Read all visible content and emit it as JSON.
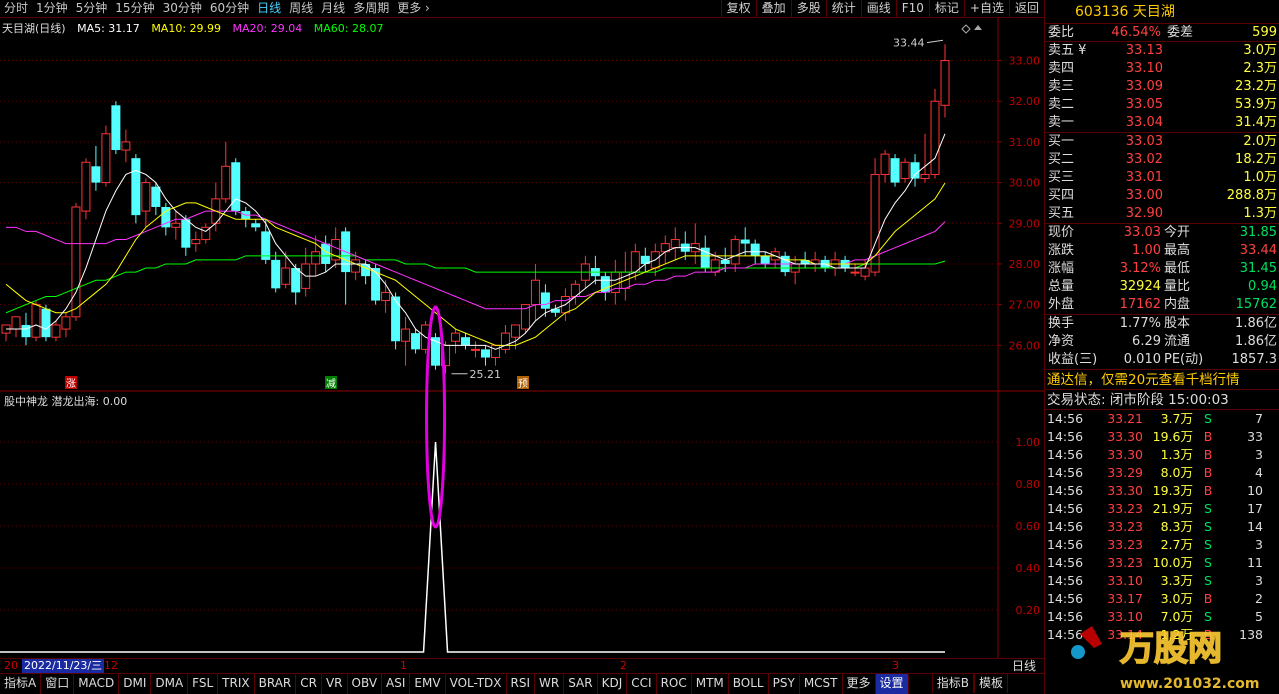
{
  "toolbar": {
    "periods": [
      "分时",
      "1分钟",
      "5分钟",
      "15分钟",
      "30分钟",
      "60分钟",
      "日线",
      "周线",
      "月线",
      "多周期",
      "更多"
    ],
    "active_period": "日线",
    "tools": [
      "复权",
      "叠加",
      "多股",
      "统计",
      "画线",
      "F10",
      "标记",
      "+自选",
      "返回"
    ]
  },
  "chart_title": {
    "name": "天目湖(日线)",
    "ma5": "MA5: 31.17",
    "ma10": "MA10: 29.99",
    "ma20": "MA20: 29.04",
    "ma60": "MA60: 28.07"
  },
  "price_axis": [
    "33.00",
    "32.00",
    "31.00",
    "30.00",
    "29.00",
    "28.00",
    "27.00",
    "26.00"
  ],
  "indicator_axis": [
    "1.00",
    "0.80",
    "0.60",
    "0.40",
    "0.20"
  ],
  "annotations": {
    "high": "33.44",
    "low": "25.21",
    "markers": [
      "涨",
      "减",
      "预"
    ]
  },
  "indicator_title": {
    "name": "股中神龙",
    "line": "潜龙出海: 0.00"
  },
  "timebar": {
    "date": "2022/11/23/三",
    "ticks": [
      "20",
      "12",
      "1",
      "2",
      "3"
    ],
    "daily": "日线"
  },
  "tabs": [
    "指标A",
    "窗口",
    "MACD",
    "DMI",
    "DMA",
    "FSL",
    "TRIX",
    "BRAR",
    "CR",
    "VR",
    "OBV",
    "ASI",
    "EMV",
    "VOL-TDX",
    "RSI",
    "WR",
    "SAR",
    "KDJ",
    "CCI",
    "ROC",
    "MTM",
    "BOLL",
    "PSY",
    "MCST",
    "更多",
    "设置"
  ],
  "tabs_right": [
    "指标B",
    "模板"
  ],
  "colors": {
    "up": "#ff3333",
    "down": "#54ffff",
    "ma5": "#ffffff",
    "ma10": "#ffff00",
    "ma20": "#ff33ff",
    "ma60": "#00ff00",
    "ellipse": "#e000e0"
  },
  "chart_data": {
    "type": "candlestick",
    "ylim": [
      25.0,
      33.8
    ],
    "candles": [
      [
        26.3,
        26.5,
        26.1,
        26.4
      ],
      [
        26.4,
        26.7,
        26.2,
        26.5
      ],
      [
        26.5,
        26.2,
        26.0,
        26.8
      ],
      [
        26.2,
        27.0,
        26.1,
        27.1
      ],
      [
        26.9,
        26.2,
        26.1,
        27.0
      ],
      [
        26.2,
        26.5,
        26.1,
        26.6
      ],
      [
        26.4,
        26.7,
        26.2,
        26.8
      ],
      [
        26.7,
        29.4,
        26.6,
        29.5
      ],
      [
        29.3,
        30.5,
        29.1,
        30.6
      ],
      [
        30.4,
        30.0,
        29.8,
        30.9
      ],
      [
        30.0,
        31.2,
        29.9,
        31.4
      ],
      [
        31.9,
        30.8,
        30.7,
        32.0
      ],
      [
        30.8,
        31.0,
        30.5,
        31.3
      ],
      [
        30.6,
        29.2,
        29.0,
        30.7
      ],
      [
        29.3,
        30.0,
        28.9,
        30.1
      ],
      [
        29.9,
        29.4,
        29.2,
        30.0
      ],
      [
        29.4,
        28.9,
        28.7,
        29.5
      ],
      [
        28.9,
        29.0,
        28.6,
        29.3
      ],
      [
        29.1,
        28.4,
        28.2,
        29.2
      ],
      [
        28.5,
        28.6,
        28.3,
        28.8
      ],
      [
        28.6,
        28.9,
        28.5,
        29.0
      ],
      [
        29.0,
        29.6,
        28.8,
        30.0
      ],
      [
        29.6,
        30.4,
        29.5,
        31.0
      ],
      [
        30.5,
        29.3,
        29.2,
        30.6
      ],
      [
        29.3,
        29.1,
        28.9,
        29.4
      ],
      [
        29.0,
        28.9,
        28.8,
        29.1
      ],
      [
        28.8,
        28.1,
        28.0,
        29.1
      ],
      [
        28.1,
        27.4,
        27.3,
        28.3
      ],
      [
        27.5,
        27.9,
        27.4,
        28.3
      ],
      [
        27.9,
        27.3,
        27.0,
        28.0
      ],
      [
        27.4,
        28.0,
        27.2,
        28.4
      ],
      [
        28.0,
        28.3,
        27.7,
        28.7
      ],
      [
        28.5,
        28.0,
        27.8,
        28.7
      ],
      [
        28.1,
        28.6,
        27.9,
        28.9
      ],
      [
        28.8,
        27.8,
        27.0,
        28.9
      ],
      [
        27.8,
        28.1,
        27.6,
        28.3
      ],
      [
        28.0,
        27.7,
        27.5,
        28.1
      ],
      [
        27.9,
        27.1,
        27.0,
        28.0
      ],
      [
        27.1,
        27.3,
        26.8,
        27.6
      ],
      [
        27.2,
        26.1,
        25.9,
        27.3
      ],
      [
        26.1,
        26.4,
        25.5,
        26.7
      ],
      [
        26.3,
        25.9,
        25.8,
        26.4
      ],
      [
        25.9,
        26.5,
        25.8,
        26.6
      ],
      [
        26.2,
        25.5,
        25.4,
        26.3
      ],
      [
        25.5,
        26.0,
        25.3,
        26.1
      ],
      [
        26.1,
        26.3,
        25.8,
        26.4
      ],
      [
        26.2,
        26.0,
        25.9,
        26.3
      ],
      [
        25.9,
        25.9,
        25.7,
        26.1
      ],
      [
        25.9,
        25.7,
        25.5,
        26.0
      ],
      [
        25.7,
        26.0,
        25.5,
        26.0
      ],
      [
        25.9,
        26.3,
        25.8,
        26.5
      ],
      [
        26.2,
        26.5,
        25.9,
        26.5
      ],
      [
        26.4,
        27.0,
        26.3,
        27.0
      ],
      [
        27.0,
        27.6,
        26.6,
        28.0
      ],
      [
        27.3,
        26.9,
        26.7,
        27.5
      ],
      [
        26.9,
        26.8,
        26.7,
        27.0
      ],
      [
        26.8,
        27.2,
        26.6,
        27.4
      ],
      [
        27.2,
        27.5,
        27.0,
        27.6
      ],
      [
        27.6,
        28.0,
        27.4,
        28.2
      ],
      [
        27.9,
        27.7,
        27.5,
        28.2
      ],
      [
        27.7,
        27.3,
        27.1,
        27.8
      ],
      [
        27.3,
        27.8,
        27.0,
        28.1
      ],
      [
        27.4,
        27.8,
        27.1,
        28.3
      ],
      [
        27.8,
        28.3,
        27.6,
        28.5
      ],
      [
        28.2,
        28.0,
        27.8,
        28.4
      ],
      [
        27.9,
        28.3,
        27.7,
        28.5
      ],
      [
        28.3,
        28.5,
        28.0,
        28.7
      ],
      [
        28.4,
        28.6,
        28.1,
        28.9
      ],
      [
        28.5,
        28.3,
        28.1,
        28.8
      ],
      [
        28.3,
        28.5,
        28.0,
        29.0
      ],
      [
        28.4,
        27.9,
        27.8,
        28.7
      ],
      [
        27.8,
        28.1,
        27.7,
        28.3
      ],
      [
        28.1,
        28.0,
        27.8,
        28.4
      ],
      [
        28.0,
        28.6,
        27.8,
        28.7
      ],
      [
        28.6,
        28.5,
        28.2,
        28.9
      ],
      [
        28.5,
        28.2,
        28.0,
        28.6
      ],
      [
        28.2,
        28.0,
        27.9,
        28.3
      ],
      [
        28.1,
        28.3,
        27.9,
        28.4
      ],
      [
        28.2,
        27.8,
        27.7,
        28.3
      ],
      [
        27.8,
        28.0,
        27.5,
        28.2
      ],
      [
        28.1,
        28.0,
        27.9,
        28.3
      ],
      [
        28.0,
        28.1,
        27.8,
        28.3
      ],
      [
        28.1,
        27.9,
        27.8,
        28.2
      ],
      [
        27.9,
        28.1,
        27.7,
        28.3
      ],
      [
        28.1,
        27.9,
        27.8,
        28.2
      ],
      [
        27.8,
        27.8,
        27.7,
        28.0
      ],
      [
        27.7,
        27.9,
        27.6,
        28.1
      ],
      [
        27.8,
        30.2,
        27.7,
        30.6
      ],
      [
        30.2,
        30.7,
        30.0,
        30.8
      ],
      [
        30.6,
        30.0,
        29.9,
        30.7
      ],
      [
        30.1,
        30.5,
        30.0,
        30.6
      ],
      [
        30.5,
        30.1,
        29.9,
        30.7
      ],
      [
        30.1,
        30.2,
        30.0,
        31.2
      ],
      [
        30.2,
        32.0,
        30.1,
        32.3
      ],
      [
        31.9,
        33.0,
        31.6,
        33.4
      ]
    ],
    "ma5": [
      26.4,
      26.4,
      26.4,
      26.5,
      26.4,
      26.6,
      26.9,
      27.3,
      27.9,
      28.6,
      29.3,
      29.8,
      30.2,
      30.3,
      30.2,
      30.0,
      29.6,
      29.3,
      29.1,
      28.9,
      28.8,
      29.0,
      29.3,
      29.6,
      29.5,
      29.3,
      29.0,
      28.5,
      28.2,
      27.9,
      27.7,
      27.7,
      27.8,
      28.0,
      28.0,
      28.0,
      28.0,
      27.8,
      27.5,
      27.1,
      26.8,
      26.4,
      26.2,
      26.1,
      26.0,
      26.0,
      26.0,
      26.0,
      26.0,
      25.9,
      26.0,
      26.1,
      26.3,
      26.6,
      26.8,
      26.9,
      27.0,
      27.2,
      27.4,
      27.6,
      27.6,
      27.6,
      27.7,
      27.8,
      28.0,
      28.1,
      28.3,
      28.4,
      28.4,
      28.4,
      28.3,
      28.2,
      28.1,
      28.2,
      28.3,
      28.3,
      28.3,
      28.2,
      28.1,
      28.0,
      28.0,
      28.0,
      28.0,
      27.9,
      27.9,
      27.9,
      27.9,
      28.5,
      29.1,
      29.5,
      29.8,
      30.2,
      30.4,
      30.6,
      31.2
    ],
    "ma10": [
      27.5,
      27.3,
      27.1,
      27.0,
      26.9,
      26.8,
      26.8,
      26.9,
      27.1,
      27.3,
      27.5,
      27.8,
      28.2,
      28.6,
      28.9,
      29.1,
      29.3,
      29.4,
      29.5,
      29.5,
      29.4,
      29.3,
      29.2,
      29.1,
      29.1,
      29.1,
      29.1,
      28.9,
      28.8,
      28.7,
      28.6,
      28.5,
      28.3,
      28.2,
      28.1,
      28.0,
      27.9,
      27.8,
      27.7,
      27.6,
      27.4,
      27.2,
      27.0,
      26.8,
      26.6,
      26.4,
      26.3,
      26.2,
      26.1,
      26.0,
      26.0,
      26.0,
      26.1,
      26.2,
      26.4,
      26.6,
      26.8,
      26.9,
      27.1,
      27.3,
      27.4,
      27.5,
      27.6,
      27.7,
      27.8,
      27.9,
      28.0,
      28.1,
      28.2,
      28.2,
      28.2,
      28.2,
      28.2,
      28.2,
      28.2,
      28.2,
      28.2,
      28.2,
      28.1,
      28.1,
      28.1,
      28.0,
      28.0,
      28.0,
      28.0,
      28.0,
      28.0,
      28.2,
      28.5,
      28.8,
      29.0,
      29.2,
      29.4,
      29.6,
      29.99
    ],
    "ma20": [
      28.9,
      28.9,
      28.8,
      28.8,
      28.7,
      28.6,
      28.5,
      28.5,
      28.5,
      28.5,
      28.5,
      28.6,
      28.6,
      28.7,
      28.8,
      28.9,
      29.0,
      29.1,
      29.1,
      29.2,
      29.3,
      29.3,
      29.3,
      29.3,
      29.2,
      29.2,
      29.1,
      29.0,
      28.9,
      28.8,
      28.7,
      28.6,
      28.5,
      28.4,
      28.3,
      28.2,
      28.1,
      28.0,
      27.9,
      27.8,
      27.7,
      27.6,
      27.5,
      27.4,
      27.3,
      27.2,
      27.1,
      27.0,
      26.9,
      26.9,
      26.9,
      26.9,
      26.9,
      27.0,
      27.0,
      27.1,
      27.1,
      27.2,
      27.2,
      27.3,
      27.3,
      27.4,
      27.4,
      27.5,
      27.5,
      27.6,
      27.6,
      27.7,
      27.7,
      27.8,
      27.8,
      27.8,
      27.9,
      27.9,
      27.9,
      28.0,
      28.0,
      28.0,
      28.0,
      28.0,
      28.0,
      28.0,
      28.0,
      28.0,
      28.0,
      28.1,
      28.1,
      28.2,
      28.3,
      28.4,
      28.5,
      28.6,
      28.7,
      28.8,
      29.04
    ],
    "ma60": [
      26.8,
      26.9,
      27.0,
      27.1,
      27.2,
      27.2,
      27.3,
      27.4,
      27.5,
      27.6,
      27.6,
      27.7,
      27.8,
      27.8,
      27.9,
      27.9,
      28.0,
      28.0,
      28.0,
      28.1,
      28.1,
      28.1,
      28.1,
      28.1,
      28.2,
      28.2,
      28.2,
      28.2,
      28.2,
      28.2,
      28.2,
      28.2,
      28.2,
      28.2,
      28.2,
      28.2,
      28.1,
      28.1,
      28.1,
      28.1,
      28.0,
      28.0,
      28.0,
      27.9,
      27.9,
      27.9,
      27.9,
      27.8,
      27.8,
      27.8,
      27.8,
      27.8,
      27.8,
      27.8,
      27.8,
      27.8,
      27.8,
      27.8,
      27.8,
      27.8,
      27.8,
      27.8,
      27.8,
      27.8,
      27.8,
      27.8,
      27.9,
      27.9,
      27.9,
      27.9,
      27.9,
      27.9,
      27.9,
      27.9,
      27.9,
      27.9,
      27.9,
      27.9,
      27.9,
      27.9,
      27.9,
      27.9,
      27.9,
      27.9,
      27.9,
      27.9,
      28.0,
      28.0,
      28.0,
      28.0,
      28.0,
      28.0,
      28.0,
      28.0,
      28.07
    ],
    "indicator": {
      "ylim": [
        0,
        1.2
      ],
      "spike_index": 43,
      "spike_value": 1.0
    }
  },
  "panel": {
    "code": "603136",
    "name": "天目湖",
    "weibi": {
      "label": "委比",
      "value": "46.54%",
      "label2": "委差",
      "value2": "599"
    },
    "asks": [
      {
        "label": "卖五 ¥",
        "price": "33.13",
        "vol": "3.0万"
      },
      {
        "label": "卖四",
        "price": "33.10",
        "vol": "2.3万"
      },
      {
        "label": "卖三",
        "price": "33.09",
        "vol": "23.2万"
      },
      {
        "label": "卖二",
        "price": "33.05",
        "vol": "53.9万"
      },
      {
        "label": "卖一",
        "price": "33.04",
        "vol": "31.4万"
      }
    ],
    "bids": [
      {
        "label": "买一",
        "price": "33.03",
        "vol": "2.0万"
      },
      {
        "label": "买二",
        "price": "33.02",
        "vol": "18.2万"
      },
      {
        "label": "买三",
        "price": "33.01",
        "vol": "1.0万"
      },
      {
        "label": "买四",
        "price": "33.00",
        "vol": "288.8万"
      },
      {
        "label": "买五",
        "price": "32.90",
        "vol": "1.3万"
      }
    ],
    "quote": [
      {
        "l1": "现价",
        "v1": "33.03",
        "c1": "red",
        "l2": "今开",
        "v2": "31.85",
        "c2": "green"
      },
      {
        "l1": "涨跌",
        "v1": "1.00",
        "c1": "red",
        "l2": "最高",
        "v2": "33.44",
        "c2": "red"
      },
      {
        "l1": "涨幅",
        "v1": "3.12%",
        "c1": "red",
        "l2": "最低",
        "v2": "31.45",
        "c2": "green"
      },
      {
        "l1": "总量",
        "v1": "32924",
        "c1": "yellow",
        "l2": "量比",
        "v2": "0.94",
        "c2": "green"
      },
      {
        "l1": "外盘",
        "v1": "17162",
        "c1": "red",
        "l2": "内盘",
        "v2": "15762",
        "c2": "green"
      }
    ],
    "fund": [
      {
        "l1": "换手",
        "v1": "1.77%",
        "l2": "股本",
        "v2": "1.86亿"
      },
      {
        "l1": "净资",
        "v1": "6.29",
        "l2": "流通",
        "v2": "1.86亿"
      },
      {
        "l1": "收益(三)",
        "v1": "0.010",
        "l2": "PE(动)",
        "v2": "1857.3"
      }
    ],
    "promo": "通达信，仅需20元查看千档行情",
    "trade_state": "交易状态: 闭市阶段 15:00:03",
    "ticks": [
      {
        "t": "14:56",
        "p": "33.21",
        "v": "3.7万",
        "s": "S",
        "n": "7"
      },
      {
        "t": "14:56",
        "p": "33.30",
        "v": "19.6万",
        "s": "B",
        "n": "33"
      },
      {
        "t": "14:56",
        "p": "33.30",
        "v": "1.3万",
        "s": "B",
        "n": "3"
      },
      {
        "t": "14:56",
        "p": "33.29",
        "v": "8.0万",
        "s": "B",
        "n": "4"
      },
      {
        "t": "14:56",
        "p": "33.30",
        "v": "19.3万",
        "s": "B",
        "n": "10"
      },
      {
        "t": "14:56",
        "p": "33.23",
        "v": "21.9万",
        "s": "S",
        "n": "17"
      },
      {
        "t": "14:56",
        "p": "33.23",
        "v": "8.3万",
        "s": "S",
        "n": "14"
      },
      {
        "t": "14:56",
        "p": "33.23",
        "v": "2.7万",
        "s": "S",
        "n": "3"
      },
      {
        "t": "14:56",
        "p": "33.23",
        "v": "10.0万",
        "s": "S",
        "n": "11"
      },
      {
        "t": "14:56",
        "p": "33.10",
        "v": "3.3万",
        "s": "S",
        "n": "3"
      },
      {
        "t": "14:56",
        "p": "33.17",
        "v": "3.0万",
        "s": "B",
        "n": "2"
      },
      {
        "t": "14:56",
        "p": "33.10",
        "v": "7.0万",
        "s": "S",
        "n": "5"
      },
      {
        "t": "14:56",
        "p": "33.14",
        "v": "1.2万",
        "s": "B",
        "n": "138"
      }
    ],
    "watermark": "万股网",
    "watermark_url": "www.201032.com"
  }
}
